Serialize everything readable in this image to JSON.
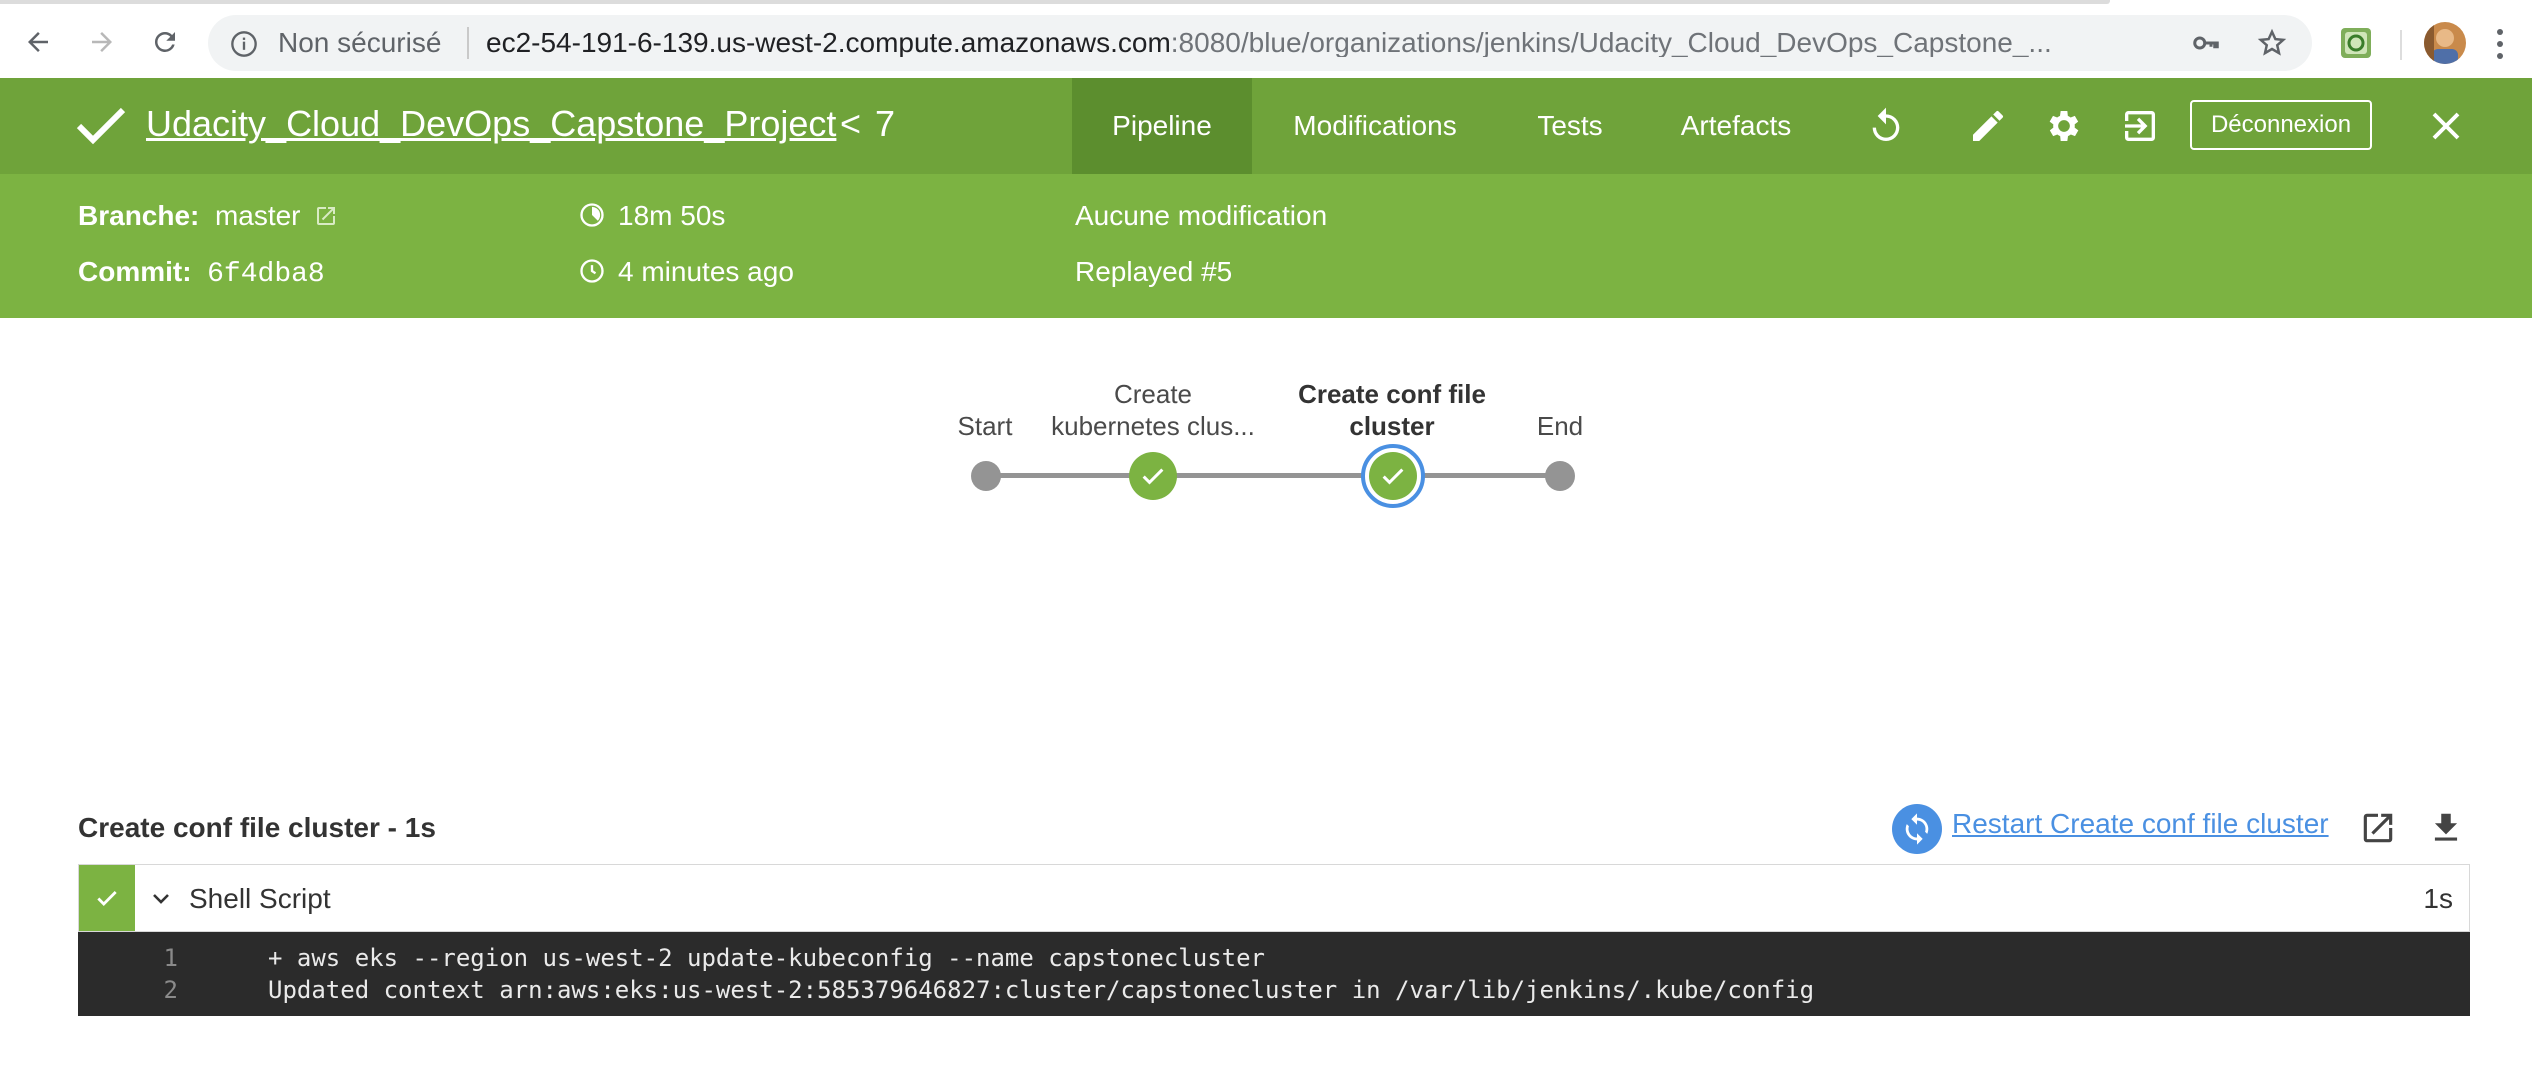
{
  "browser": {
    "security_label": "Non sécurisé",
    "url_host": "ec2-54-191-6-139.us-west-2.compute.amazonaws.com",
    "url_rest": ":8080/blue/organizations/jenkins/Udacity_Cloud_DevOps_Capstone_...",
    "icons": [
      "back-arrow-icon",
      "forward-arrow-icon",
      "reload-icon",
      "info-icon",
      "key-icon",
      "star-icon",
      "extension-icon",
      "profile-avatar",
      "kebab-menu-icon"
    ]
  },
  "header": {
    "project_title": "Udacity_Cloud_DevOps_Capstone_Project",
    "run_number": "7",
    "tabs": [
      {
        "label": "Pipeline",
        "active": true
      },
      {
        "label": "Modifications",
        "active": false
      },
      {
        "label": "Tests",
        "active": false
      },
      {
        "label": "Artefacts",
        "active": false
      }
    ],
    "logout_label": "Déconnexion"
  },
  "run": {
    "branch_label": "Branche:",
    "branch_value": "master",
    "commit_label": "Commit:",
    "commit_value": "6f4dba8",
    "duration": "18m 50s",
    "started": "4 minutes ago",
    "changes": "Aucune modification",
    "replayed": "Replayed #5"
  },
  "pipeline": {
    "stages": [
      {
        "label": "Start",
        "status": "none"
      },
      {
        "label_line1": "Create",
        "label_line2": "kubernetes clus...",
        "status": "success"
      },
      {
        "label_line1": "Create conf file",
        "label_line2": "cluster",
        "status": "success",
        "selected": true
      },
      {
        "label": "End",
        "status": "none"
      }
    ]
  },
  "step_panel": {
    "title": "Create conf file cluster - 1s",
    "restart_label": "Restart Create conf file cluster",
    "step": {
      "name": "Shell Script",
      "duration": "1s",
      "status": "success"
    },
    "log": [
      {
        "n": "1",
        "text": "+ aws eks --region us-west-2 update-kubeconfig --name capstonecluster"
      },
      {
        "n": "2",
        "text": "Updated context arn:aws:eks:us-west-2:585379646827:cluster/capstonecluster in /var/lib/jenkins/.kube/config"
      }
    ]
  },
  "colors": {
    "header_green": "#6fa33a",
    "details_green": "#7cb342",
    "success_green": "#7cb342",
    "selection_blue": "#4a90e2",
    "console_bg": "#2b2b2b"
  }
}
